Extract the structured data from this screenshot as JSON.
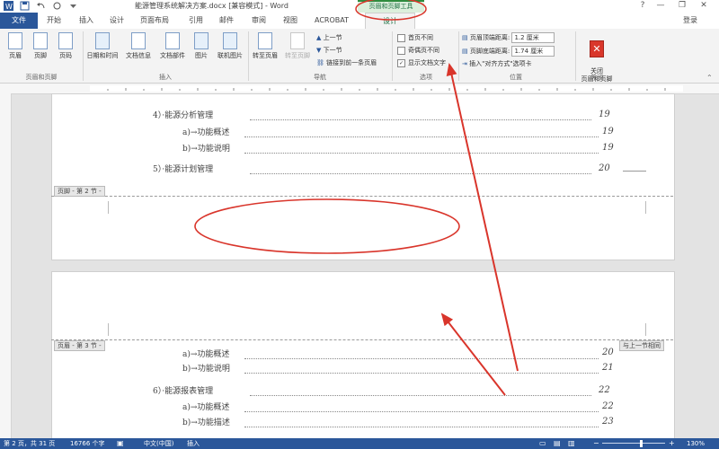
{
  "window": {
    "title": "能源管理系统解决方案.docx [兼容模式] - Word",
    "contextual_group": "页眉和页脚工具",
    "controls": [
      "?",
      "—",
      "❐",
      "✕"
    ]
  },
  "tabs": {
    "file": "文件",
    "items": [
      "开始",
      "插入",
      "设计",
      "页面布局",
      "引用",
      "邮件",
      "审阅",
      "视图",
      "ACROBAT"
    ],
    "active": "设计",
    "login": "登录"
  },
  "ribbon": {
    "header_footer": {
      "buttons": [
        "页眉",
        "页脚",
        "页码"
      ],
      "label": "页眉和页脚"
    },
    "insert": {
      "buttons": [
        "日期和时间",
        "文档信息",
        "文档部件",
        "图片",
        "联机图片"
      ],
      "label": "插入"
    },
    "navigation": {
      "buttons": [
        "转至页眉",
        "转至页脚"
      ],
      "small": [
        "上一节",
        "下一节",
        "链接到前一条页眉"
      ],
      "label": "导航"
    },
    "options": {
      "checkboxes": [
        {
          "label": "首页不同",
          "checked": false
        },
        {
          "label": "奇偶页不同",
          "checked": false
        },
        {
          "label": "显示文档文字",
          "checked": true
        }
      ],
      "label": "选项"
    },
    "position": {
      "header_top_label": "页眉顶端距离:",
      "header_top_value": "1.2 厘米",
      "footer_bottom_label": "页脚底端距离:",
      "footer_bottom_value": "1.74 厘米",
      "align_tab": "插入\"对齐方式\"选项卡",
      "label": "位置"
    },
    "close": {
      "button": "关闭\n页眉和页脚",
      "label": "关闭"
    }
  },
  "page1": {
    "toc": [
      {
        "text": "4）·能源分析管理",
        "page": "19"
      },
      {
        "text": "a)→功能概述",
        "page": "19"
      },
      {
        "text": "b)→功能说明",
        "page": "19"
      },
      {
        "text": "5）·能源计划管理",
        "page": "20"
      }
    ],
    "footer_label": "页脚 - 第 2 节 -"
  },
  "page2": {
    "header_label": "页眉 - 第 3 节 -",
    "link_label": "与上一节相同",
    "toc": [
      {
        "text": "a)→功能概述",
        "page": "20"
      },
      {
        "text": "b)→功能说明",
        "page": "21"
      },
      {
        "text": "6）·能源报表管理",
        "page": "22"
      },
      {
        "text": "a)→功能概述",
        "page": "22"
      },
      {
        "text": "b)→功能描述",
        "page": "23"
      }
    ]
  },
  "status": {
    "page": "第 2 页，共 31 页",
    "words": "16766 个字",
    "language": "中文(中国)",
    "mode": "插入",
    "zoom": "130%"
  },
  "colors": {
    "accent": "#2b579a",
    "contextual": "#217346",
    "annotation": "#d9352b"
  }
}
